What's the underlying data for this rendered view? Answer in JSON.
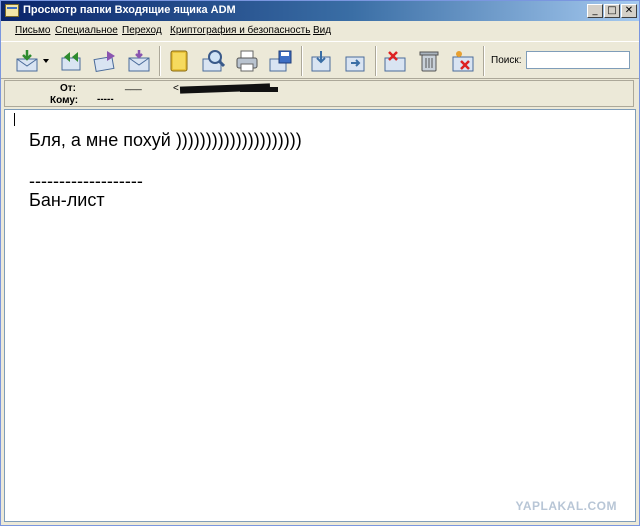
{
  "window": {
    "title": "Просмотр папки Входящие ящика ADM",
    "controls": {
      "minimize": "_",
      "maximize": "□",
      "close": "✕"
    }
  },
  "menu": {
    "items": [
      "Письмо",
      "Специальное",
      "Переход",
      "Криптография и безопасность",
      "Вид"
    ]
  },
  "toolbar": {
    "icons": [
      "get-mail-icon",
      "reply-icon",
      "forward-icon",
      "new-message-icon",
      "address-book-icon",
      "find-icon",
      "print-icon",
      "save-icon",
      "move-icon",
      "copy-icon",
      "delete-message-icon",
      "trash-icon",
      "spam-icon"
    ],
    "search_label": "Поиск:",
    "search_value": ""
  },
  "header": {
    "from_label": "От:",
    "from_value": "___",
    "from_email_prefix": "<",
    "to_label": "Кому:",
    "to_value": "-----"
  },
  "message": {
    "line1": "Бля, а мне похуй )))))))))))))))))))))",
    "line2": "-------------------",
    "line3": "Бан-лист"
  },
  "watermark": "YAPLAKAL.COM",
  "colors": {
    "accent": "#3a6ea5",
    "titlebar_start": "#0a246a",
    "background": "#ece9d8"
  }
}
